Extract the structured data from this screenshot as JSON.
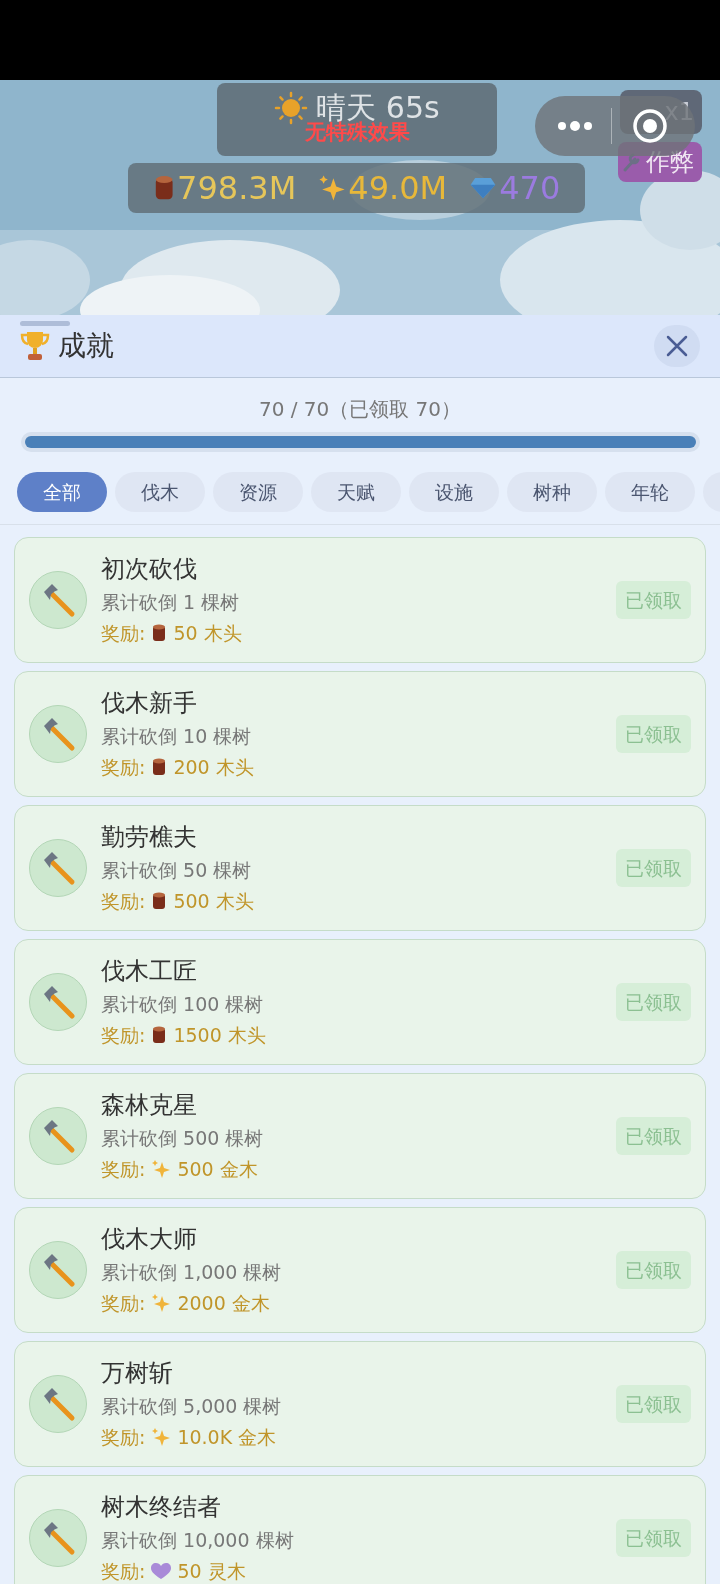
{
  "weather": {
    "name": "晴天",
    "time": "65s",
    "effect": "无特殊效果"
  },
  "resources": [
    {
      "kind": "wood",
      "value": "798.3M"
    },
    {
      "kind": "sparkle",
      "value": "49.0M"
    },
    {
      "kind": "gem",
      "value": "470"
    }
  ],
  "speed_button": {
    "label": "x1"
  },
  "cheat_button": {
    "label": "作弊"
  },
  "panel": {
    "title": "成就",
    "progress_text": "70 / 70（已领取 70）",
    "level": 1.0
  },
  "tabs": [
    {
      "label": "全部",
      "selected": true
    },
    {
      "label": "伐木",
      "selected": false
    },
    {
      "label": "资源",
      "selected": false
    },
    {
      "label": "天赋",
      "selected": false
    },
    {
      "label": "设施",
      "selected": false
    },
    {
      "label": "树种",
      "selected": false
    },
    {
      "label": "年轮",
      "selected": false
    }
  ],
  "achievements": [
    {
      "title": "初次砍伐",
      "description": "累计砍倒 1 棵树",
      "reward_label": "奖励:",
      "reward": {
        "kind": "wood",
        "amount": "50 木头"
      },
      "status": "已领取"
    },
    {
      "title": "伐木新手",
      "description": "累计砍倒 10 棵树",
      "reward_label": "奖励:",
      "reward": {
        "kind": "wood",
        "amount": "200 木头"
      },
      "status": "已领取"
    },
    {
      "title": "勤劳樵夫",
      "description": "累计砍倒 50 棵树",
      "reward_label": "奖励:",
      "reward": {
        "kind": "wood",
        "amount": "500 木头"
      },
      "status": "已领取"
    },
    {
      "title": "伐木工匠",
      "description": "累计砍倒 100 棵树",
      "reward_label": "奖励:",
      "reward": {
        "kind": "wood",
        "amount": "1500 木头"
      },
      "status": "已领取"
    },
    {
      "title": "森林克星",
      "description": "累计砍倒 500 棵树",
      "reward_label": "奖励:",
      "reward": {
        "kind": "sparkle",
        "amount": "500 金木"
      },
      "status": "已领取"
    },
    {
      "title": "伐木大师",
      "description": "累计砍倒 1,000 棵树",
      "reward_label": "奖励:",
      "reward": {
        "kind": "sparkle",
        "amount": "2000 金木"
      },
      "status": "已领取"
    },
    {
      "title": "万树斩",
      "description": "累计砍倒 5,000 棵树",
      "reward_label": "奖励:",
      "reward": {
        "kind": "sparkle",
        "amount": "10.0K 金木"
      },
      "status": "已领取"
    },
    {
      "title": "树木终结者",
      "description": "累计砍倒 10,000 棵树",
      "reward_label": "奖励:",
      "reward": {
        "kind": "heart",
        "amount": "50 灵木"
      },
      "status": "已领取"
    }
  ]
}
